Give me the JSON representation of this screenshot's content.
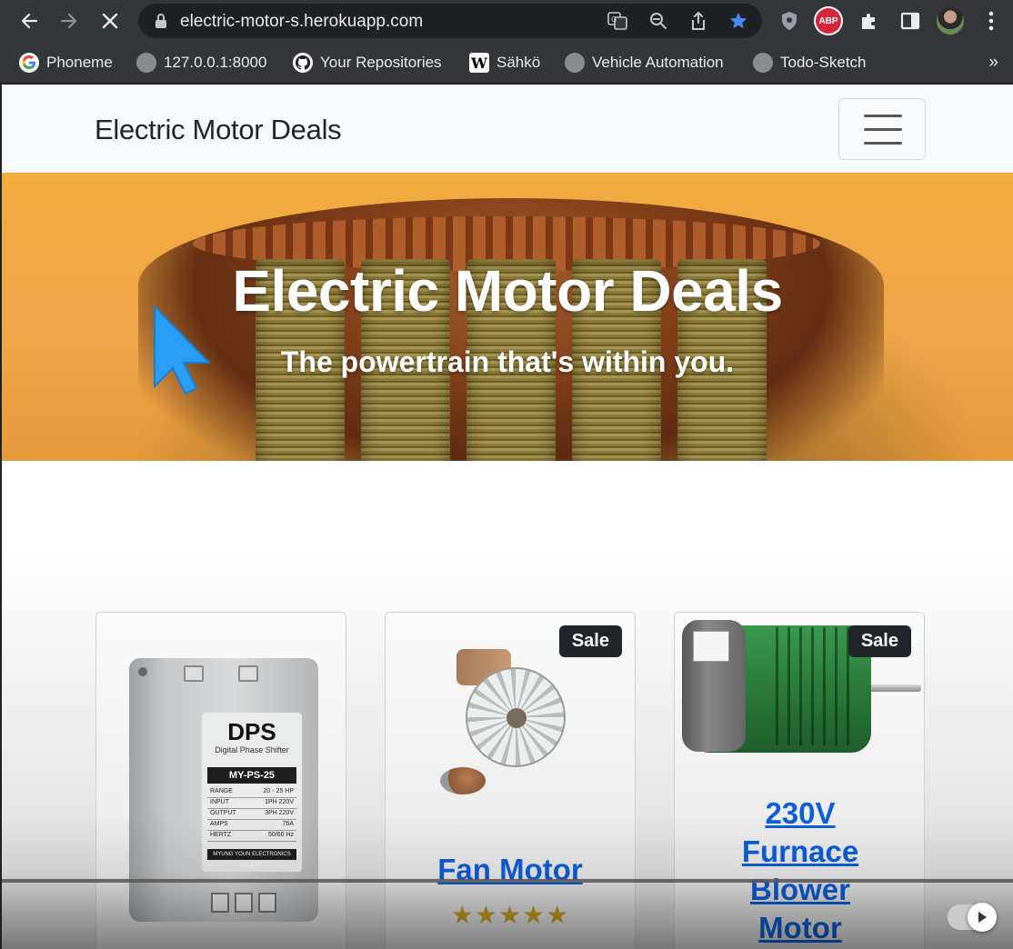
{
  "browser": {
    "url": "electric-motor-s.herokuapp.com",
    "bookmarks": [
      {
        "label": "Phoneme",
        "icon": "google-icon"
      },
      {
        "label": "127.0.0.1:8000",
        "icon": "globe-icon"
      },
      {
        "label": "Your Repositories",
        "icon": "github-icon"
      },
      {
        "label": "Sähkö",
        "icon": "wikipedia-icon"
      },
      {
        "label": "Vehicle Automation",
        "icon": "globe-icon"
      },
      {
        "label": "Todo-Sketch",
        "icon": "globe-icon"
      }
    ],
    "bookmarks_more": "»",
    "extensions": {
      "abp": "ABP"
    },
    "accent": "#4a8af4"
  },
  "page": {
    "brand": "Electric Motor Deals",
    "hero": {
      "title": "Electric Motor Deals",
      "subtitle": "The powertrain that's within you."
    },
    "products": [
      {
        "name": "",
        "badge": "",
        "image": {
          "logo": "DPS",
          "subtitle": "Digital Phase Shifter",
          "model": "MY-PS-25",
          "specs": [
            {
              "k": "RANGE",
              "v": "20 - 25 HP"
            },
            {
              "k": "INPUT",
              "v": "1PH 220V"
            },
            {
              "k": "OUTPUT",
              "v": "3PH 220V"
            },
            {
              "k": "AMPS",
              "v": "76A"
            },
            {
              "k": "HERTZ",
              "v": "50/60 Hz"
            }
          ],
          "maker": "MYUNG YOUN ELECTRONICS CO.,LTD."
        }
      },
      {
        "name": "Fan Motor",
        "badge": "Sale",
        "rating": 5,
        "stars": "★★★★★"
      },
      {
        "name": "230V Furnace Blower Motor",
        "badge": "Sale"
      }
    ]
  }
}
